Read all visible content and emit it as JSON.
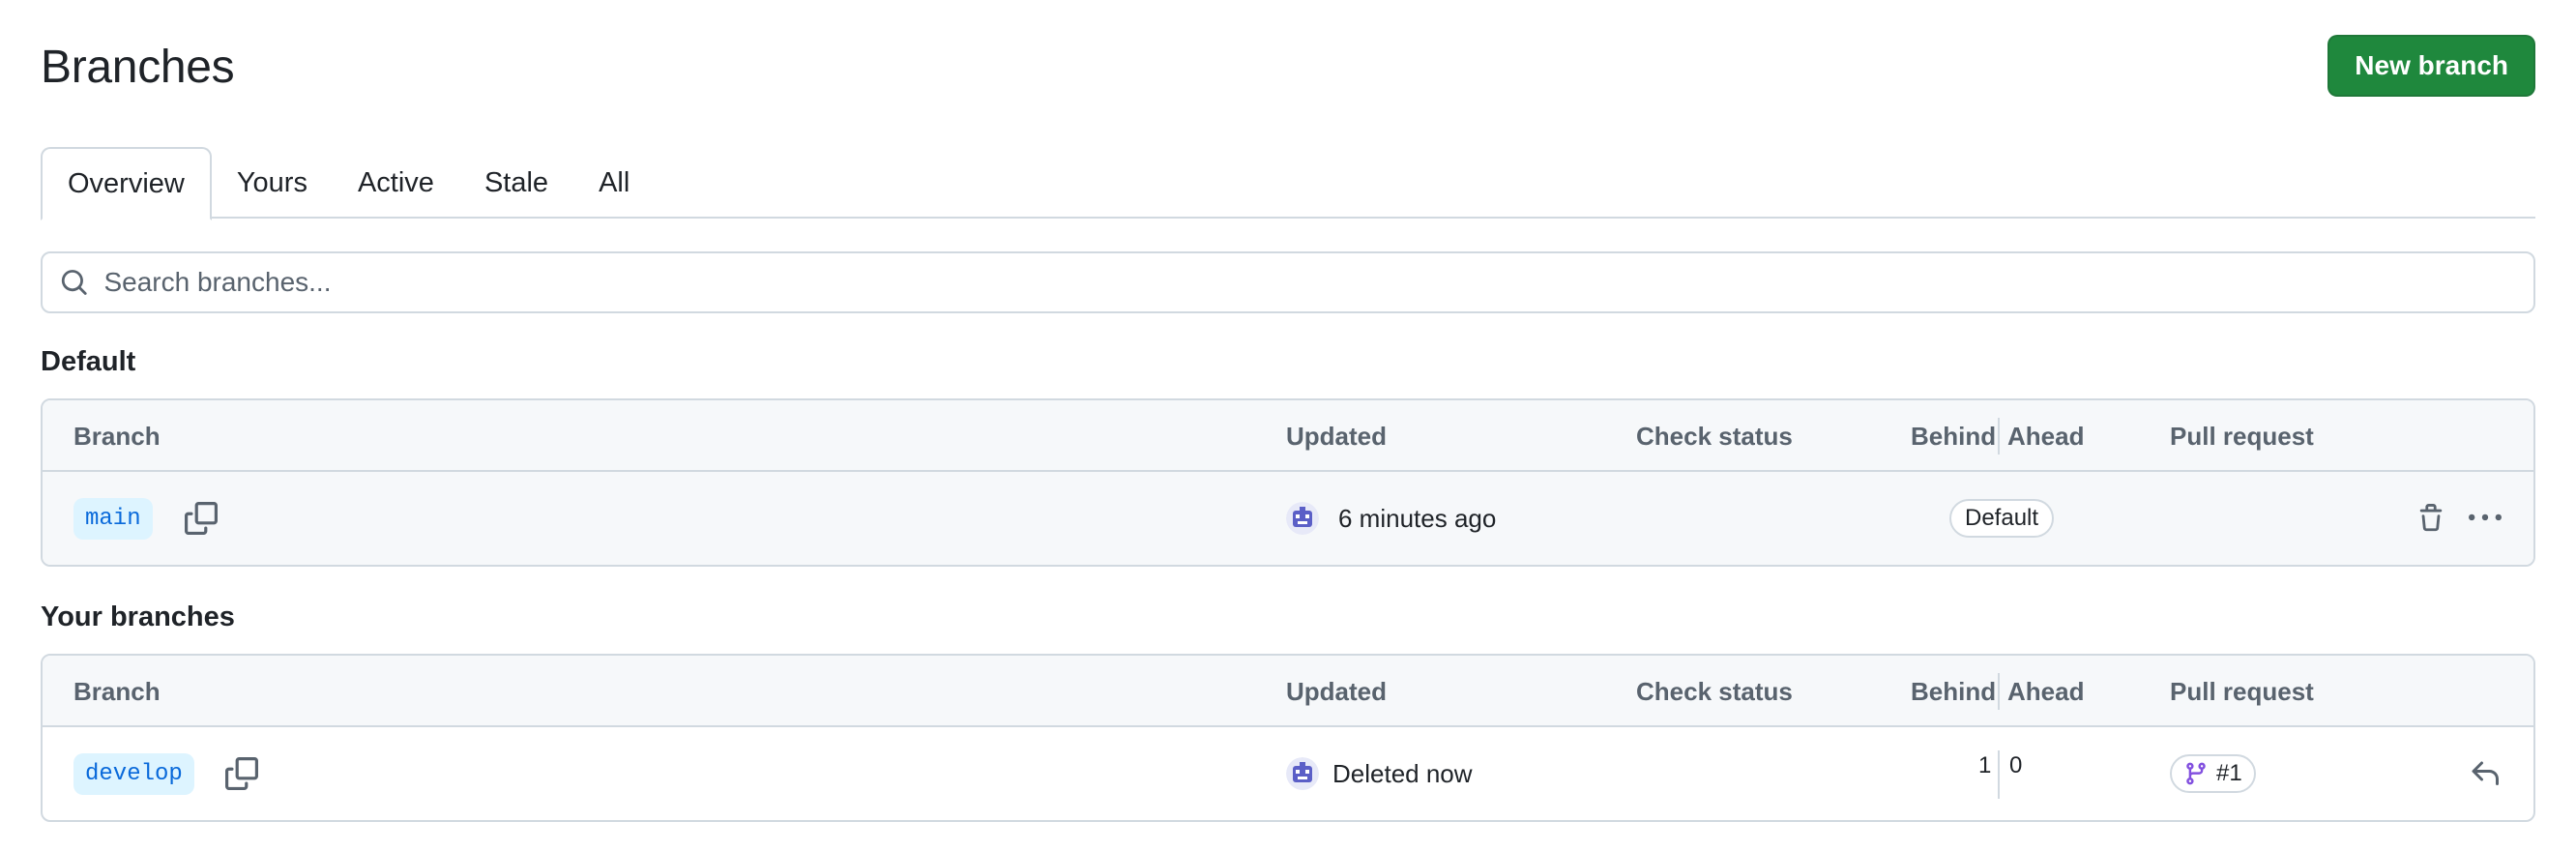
{
  "header": {
    "title": "Branches",
    "new_branch_label": "New branch"
  },
  "tabs": [
    {
      "label": "Overview",
      "selected": true
    },
    {
      "label": "Yours",
      "selected": false
    },
    {
      "label": "Active",
      "selected": false
    },
    {
      "label": "Stale",
      "selected": false
    },
    {
      "label": "All",
      "selected": false
    }
  ],
  "search": {
    "placeholder": "Search branches...",
    "value": ""
  },
  "columns": {
    "branch": "Branch",
    "updated": "Updated",
    "check_status": "Check status",
    "behind": "Behind",
    "ahead": "Ahead",
    "pull_request": "Pull request"
  },
  "default_section": {
    "heading": "Default",
    "rows": [
      {
        "branch": "main",
        "updated": "6 minutes ago",
        "badge": "Default",
        "actions": [
          "trash-icon",
          "kebab-menu-icon"
        ]
      }
    ]
  },
  "your_section": {
    "heading": "Your branches",
    "rows": [
      {
        "branch": "develop",
        "updated": "Deleted now",
        "behind": "1",
        "ahead": "0",
        "pull_request": "#1",
        "actions": [
          "restore-icon"
        ]
      }
    ]
  },
  "colors": {
    "primary_button": "#1f883d",
    "link_blue": "#0969da",
    "branch_pill_bg": "#ddf4ff",
    "pr_icon": "#8250df",
    "border": "#d1d9e0",
    "muted_text": "#59636e"
  }
}
